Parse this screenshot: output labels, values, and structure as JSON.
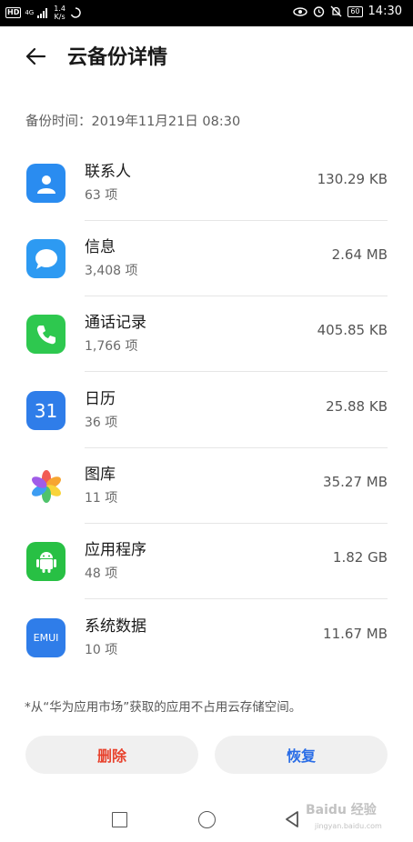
{
  "status_bar": {
    "hd_label": "HD",
    "network_label": "4G",
    "speed_value": "1.4",
    "speed_unit": "K/s",
    "battery": "60",
    "time": "14:30"
  },
  "header": {
    "title": "云备份详情"
  },
  "backup_time": "备份时间：2019年11月21日 08:30",
  "items": [
    {
      "title": "联系人",
      "count": "63 项",
      "size": "130.29 KB",
      "icon": "contacts-icon",
      "color": "#2a8cf0"
    },
    {
      "title": "信息",
      "count": "3,408 项",
      "size": "2.64 MB",
      "icon": "messages-icon",
      "color": "#2d9af2"
    },
    {
      "title": "通话记录",
      "count": "1,766 项",
      "size": "405.85 KB",
      "icon": "phone-icon",
      "color": "#2ec84f"
    },
    {
      "title": "日历",
      "count": "36 项",
      "size": "25.88 KB",
      "icon": "calendar-icon",
      "color": "#2f7de9",
      "icon_text": "31"
    },
    {
      "title": "图库",
      "count": "11 项",
      "size": "35.27 MB",
      "icon": "gallery-icon",
      "color": "#ffffff"
    },
    {
      "title": "应用程序",
      "count": "48 项",
      "size": "1.82 GB",
      "icon": "android-icon",
      "color": "#28c044"
    },
    {
      "title": "系统数据",
      "count": "10 项",
      "size": "11.67 MB",
      "icon": "emui-icon",
      "color": "#2f7de9",
      "icon_text": "EMUI"
    }
  ],
  "footnote": "*从“华为应用市场”获取的应用不占用云存储空间。",
  "buttons": {
    "delete": "删除",
    "restore": "恢复"
  },
  "watermark": {
    "text": "Baidu 经验",
    "sub": "jingyan.baidu.com"
  }
}
